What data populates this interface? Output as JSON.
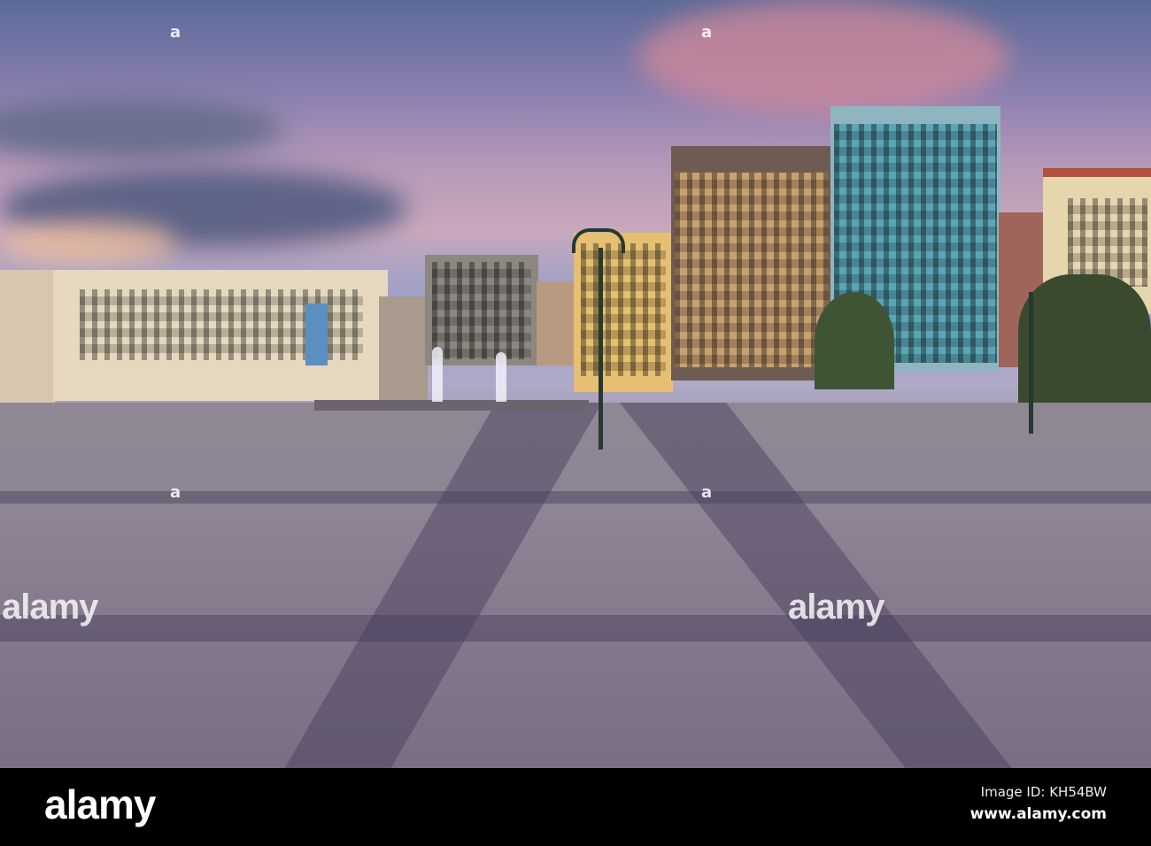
{
  "watermark": {
    "small_mark": "a",
    "large_text": "alamy"
  },
  "footer": {
    "logo": "alamy",
    "image_id": "Image ID: KH54BW",
    "url": "www.alamy.com"
  },
  "colors": {
    "sky_top": "#5a6a98",
    "sky_pink": "#c9a8bc",
    "plaza": "#8d8494",
    "footer": "#000000"
  }
}
